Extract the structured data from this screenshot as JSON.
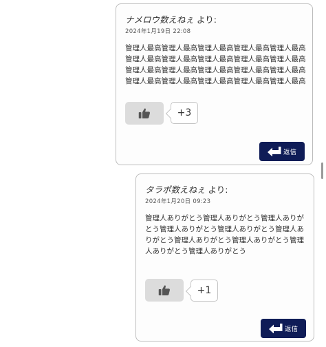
{
  "comments": [
    {
      "author": "ナメロウ数えねぇ",
      "author_suffix": " より:",
      "timestamp": "2024年1月19日 22:08",
      "body": "管理人最高管理人最高管理人最高管理人最高管理人最高管理人最高管理人最高管理人最高管理人最高管理人最高管理人最高管理人最高管理人最高管理人最高管理人最高管理人最高管理人最高管理人最高管理人最高管理人最高",
      "like_count": "+3",
      "reply_label": "返信"
    },
    {
      "author": "タラポ数えねぇ",
      "author_suffix": " より:",
      "timestamp": "2024年1月20日 09:23",
      "body": "管理人ありがとう管理人ありがとう管理人ありがとう管理人ありがとう管理人ありがとう管理人ありがとう管理人ありがとう管理人ありがとう管理人ありがとう管理人ありがとう",
      "like_count": "+1",
      "reply_label": "返信"
    }
  ],
  "icons": {
    "like": "thumbs-up-icon",
    "reply": "reply-arrow-icon"
  },
  "colors": {
    "reply_button_bg": "#0f1c57",
    "like_button_bg": "#dcdcdc",
    "card_border": "#bdbdbd"
  }
}
